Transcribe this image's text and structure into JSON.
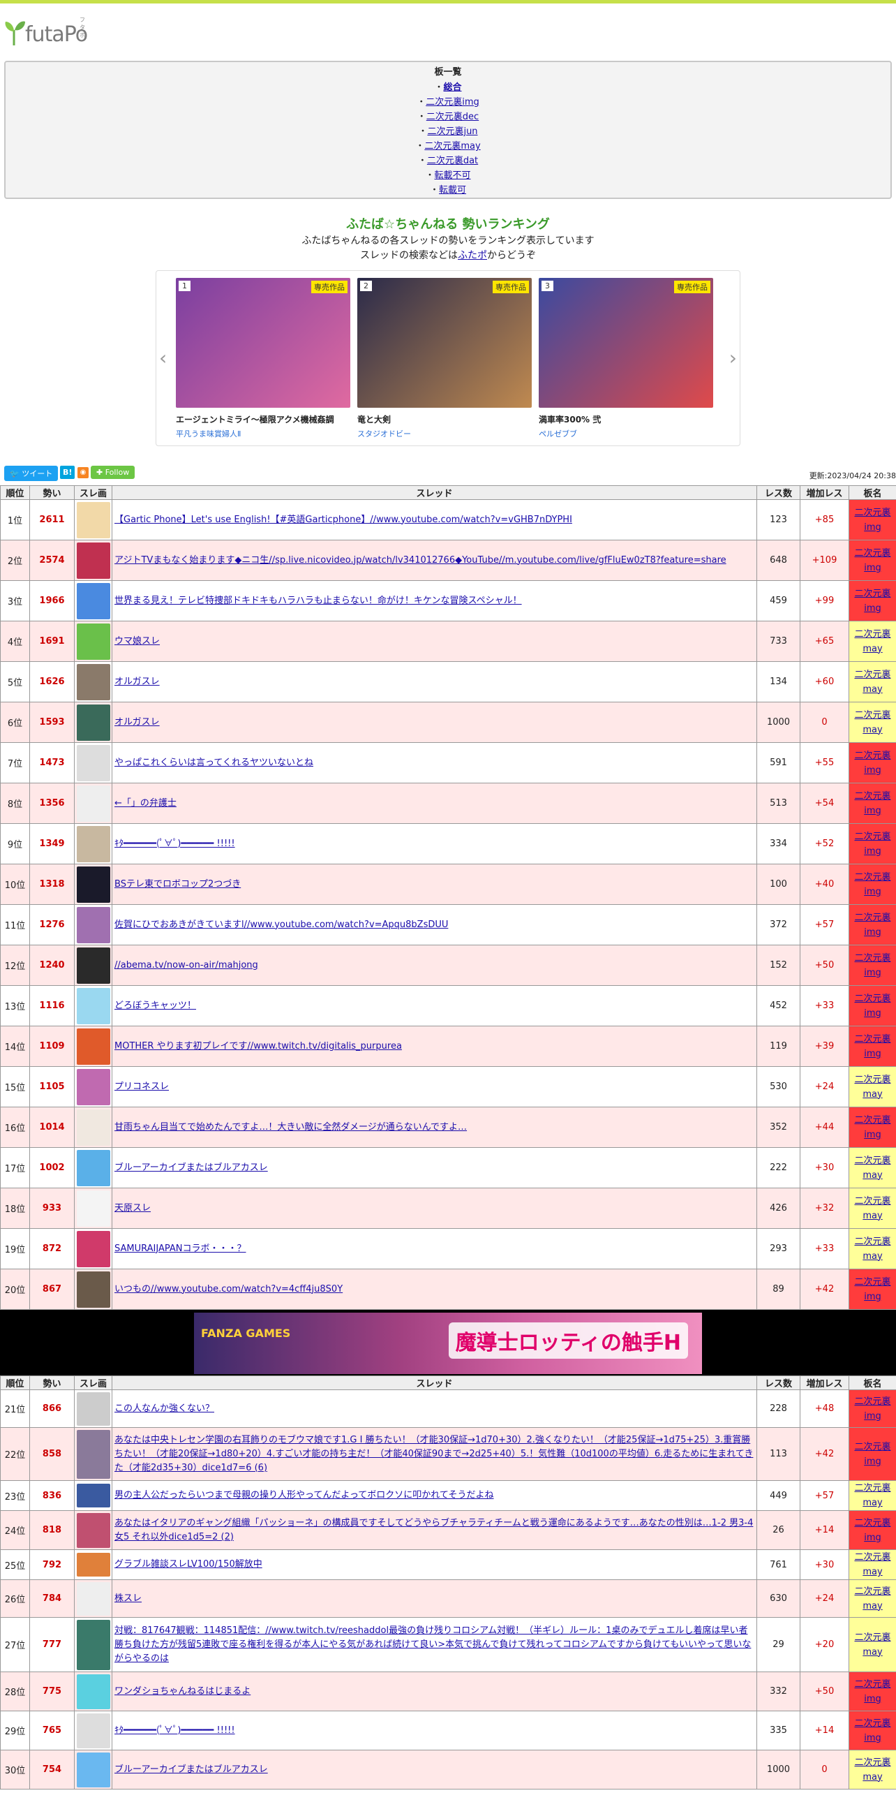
{
  "logo": {
    "text": "futaPo",
    "ruby": "フタポ"
  },
  "boards": {
    "title": "板一覧",
    "items": [
      {
        "label": "総合",
        "bold": true
      },
      {
        "label": "二次元裏img"
      },
      {
        "label": "二次元裏dec"
      },
      {
        "label": "二次元裏jun"
      },
      {
        "label": "二次元裏may"
      },
      {
        "label": "二次元裏dat"
      },
      {
        "label": "転載不可"
      },
      {
        "label": "転載可"
      }
    ]
  },
  "ranking": {
    "title": "ふたば☆ちゃんねる 勢いランキング",
    "desc1": "ふたばちゃんねるの各スレッドの勢いをランキング表示しています",
    "desc2_pre": "スレッドの検索などは",
    "desc2_link": "ふたポ",
    "desc2_post": "からどうぞ"
  },
  "carousel": [
    {
      "rank": "1",
      "badge": "専売作品",
      "title": "エージェントミライ～極限アクメ機械姦調",
      "maker": "平凡うま味賞婦人Ⅱ",
      "color1": "#7a3fa0",
      "color2": "#e06aa0"
    },
    {
      "rank": "2",
      "badge": "専売作品",
      "title": "竜と大剣",
      "maker": "スタジオドビー",
      "color1": "#2a2a4a",
      "color2": "#c08a50"
    },
    {
      "rank": "3",
      "badge": "専売作品",
      "title": "満車率300% 弐",
      "maker": "ペルゼブブ",
      "color1": "#3a4aa0",
      "color2": "#e04a4a"
    }
  ],
  "social": {
    "tweet": "ツイート",
    "hatena": "B!",
    "follow": "Follow",
    "updated": "更新:2023/04/24 20:38"
  },
  "table": {
    "headers": [
      "順位",
      "勢い",
      "スレ画",
      "スレッド",
      "レス数",
      "増加レス",
      "板名"
    ]
  },
  "rows_a": [
    {
      "pos": "1位",
      "mom": "2611",
      "title": "【Gartic Phone】Let's use English!【#英語Garticphone】//www.youtube.com/watch?v=vGHB7nDYPHI",
      "res": "123",
      "inc": "+85",
      "board1": "二次元裏",
      "board2": "img",
      "bt": "img",
      "tc": "#f2d9a8"
    },
    {
      "pos": "2位",
      "mom": "2574",
      "title": "アジトTVまもなく始まります◆ニコ生//sp.live.nicovideo.jp/watch/lv341012766◆YouTube//m.youtube.com/live/gfFluEw0zT8?feature=share",
      "res": "648",
      "inc": "+109",
      "board1": "二次元裏",
      "board2": "img",
      "bt": "img",
      "tc": "#c03050"
    },
    {
      "pos": "3位",
      "mom": "1966",
      "title": "世界まる見え！テレビ特捜部ドキドキもハラハラも止まらない！命がけ！キケンな冒険スペシャル！",
      "res": "459",
      "inc": "+99",
      "board1": "二次元裏",
      "board2": "img",
      "bt": "img",
      "tc": "#4a8ae0"
    },
    {
      "pos": "4位",
      "mom": "1691",
      "title": "ウマ娘スレ",
      "res": "733",
      "inc": "+65",
      "board1": "二次元裏",
      "board2": "may",
      "bt": "may",
      "tc": "#6ac04a"
    },
    {
      "pos": "5位",
      "mom": "1626",
      "title": "オルガスレ",
      "res": "134",
      "inc": "+60",
      "board1": "二次元裏",
      "board2": "may",
      "bt": "may",
      "tc": "#8a7a6a"
    },
    {
      "pos": "6位",
      "mom": "1593",
      "title": "オルガスレ",
      "res": "1000",
      "inc": "0",
      "board1": "二次元裏",
      "board2": "may",
      "bt": "may",
      "tc": "#3a6a5a"
    },
    {
      "pos": "7位",
      "mom": "1473",
      "title": "やっぱこれくらいは言ってくれるヤツいないとね",
      "res": "591",
      "inc": "+55",
      "board1": "二次元裏",
      "board2": "img",
      "bt": "img",
      "tc": "#dddddd"
    },
    {
      "pos": "8位",
      "mom": "1356",
      "title": "←「」の弁護士",
      "res": "513",
      "inc": "+54",
      "board1": "二次元裏",
      "board2": "img",
      "bt": "img",
      "tc": "#eeeeee"
    },
    {
      "pos": "9位",
      "mom": "1349",
      "title": "ｷﾀ━━━━━━(ﾟ∀ﾟ)━━━━━━ !!!!!",
      "res": "334",
      "inc": "+52",
      "board1": "二次元裏",
      "board2": "img",
      "bt": "img",
      "tc": "#c8b8a0"
    },
    {
      "pos": "10位",
      "mom": "1318",
      "title": "BSテレ東でロボコップ2つづき",
      "res": "100",
      "inc": "+40",
      "board1": "二次元裏",
      "board2": "img",
      "bt": "img",
      "tc": "#1a1a2a"
    },
    {
      "pos": "11位",
      "mom": "1276",
      "title": "佐賀にひでおあきがきていますl//www.youtube.com/watch?v=Apqu8bZsDUU",
      "res": "372",
      "inc": "+57",
      "board1": "二次元裏",
      "board2": "img",
      "bt": "img",
      "tc": "#a070b0"
    },
    {
      "pos": "12位",
      "mom": "1240",
      "title": "//abema.tv/now-on-air/mahjong",
      "res": "152",
      "inc": "+50",
      "board1": "二次元裏",
      "board2": "img",
      "bt": "img",
      "tc": "#2a2a2a"
    },
    {
      "pos": "13位",
      "mom": "1116",
      "title": "どろぼうキャッツ！",
      "res": "452",
      "inc": "+33",
      "board1": "二次元裏",
      "board2": "img",
      "bt": "img",
      "tc": "#9ad8f0"
    },
    {
      "pos": "14位",
      "mom": "1109",
      "title": "MOTHER やります初プレイです//www.twitch.tv/digitalis_purpurea",
      "res": "119",
      "inc": "+39",
      "board1": "二次元裏",
      "board2": "img",
      "bt": "img",
      "tc": "#e05a2a"
    },
    {
      "pos": "15位",
      "mom": "1105",
      "title": "プリコネスレ",
      "res": "530",
      "inc": "+24",
      "board1": "二次元裏",
      "board2": "may",
      "bt": "may",
      "tc": "#c06ab0"
    },
    {
      "pos": "16位",
      "mom": "1014",
      "title": "甘雨ちゃん目当てで始めたんですよ…！大きい敵に全然ダメージが通らないんですよ…",
      "res": "352",
      "inc": "+44",
      "board1": "二次元裏",
      "board2": "img",
      "bt": "img",
      "tc": "#f0e8e0"
    },
    {
      "pos": "17位",
      "mom": "1002",
      "title": "ブルーアーカイブまたはブルアカスレ",
      "res": "222",
      "inc": "+30",
      "board1": "二次元裏",
      "board2": "may",
      "bt": "may",
      "tc": "#5ab0e8"
    },
    {
      "pos": "18位",
      "mom": "933",
      "title": "天原スレ",
      "res": "426",
      "inc": "+32",
      "board1": "二次元裏",
      "board2": "may",
      "bt": "may",
      "tc": "#f4f4f4"
    },
    {
      "pos": "19位",
      "mom": "872",
      "title": "SAMURAIJAPANコラボ・・・？",
      "res": "293",
      "inc": "+33",
      "board1": "二次元裏",
      "board2": "may",
      "bt": "may",
      "tc": "#d03a6a"
    },
    {
      "pos": "20位",
      "mom": "867",
      "title": "いつもの//www.youtube.com/watch?v=4cff4ju8S0Y",
      "res": "89",
      "inc": "+42",
      "board1": "二次元裏",
      "board2": "img",
      "bt": "img",
      "tc": "#6a5a4a"
    }
  ],
  "banner": {
    "left": "FANZA GAMES",
    "right": "魔導士ロッティの触手H"
  },
  "rows_b": [
    {
      "pos": "21位",
      "mom": "866",
      "title": "この人なんか強くない？",
      "res": "228",
      "inc": "+48",
      "board1": "二次元裏",
      "board2": "img",
      "bt": "img",
      "tc": "#cccccc",
      "h": 54
    },
    {
      "pos": "22位",
      "mom": "858",
      "title": "あなたは中央トレセン学園の右耳飾りのモブウマ娘です1.G I 勝ちたい！（才能30保証→1d70+30）2.強くなりたい！（才能25保証→1d75+25）3.重賞勝ちたい！（才能20保証→1d80+20）4.すごい才能の持ち主だ！（才能40保証90まで→2d25+40）5.！気性難（10d100の平均値）6.走るために生まれてきた（才能2d35+30）dice1d7=6 (6)",
      "res": "113",
      "inc": "+42",
      "board1": "二次元裏",
      "board2": "img",
      "bt": "img",
      "tc": "#8a7a9a",
      "h": 76
    },
    {
      "pos": "23位",
      "mom": "836",
      "title": "男の主人公だったらいつまで母親の操り人形やってんだよってボロクソに叩かれてそうだよね",
      "res": "449",
      "inc": "+57",
      "board1": "二次元裏",
      "board2": "may",
      "bt": "may",
      "tc": "#3a5aa0",
      "h": 40
    },
    {
      "pos": "24位",
      "mom": "818",
      "title": "あなたはイタリアのギャング組織「パッショーネ」の構成員ですそしてどうやらブチャラティチームと戦う運命にあるようです…あなたの性別は…1-2 男3-4 女5 それ以外dice1d5=2 (2)",
      "res": "26",
      "inc": "+14",
      "board1": "二次元裏",
      "board2": "img",
      "bt": "img",
      "tc": "#c05070",
      "h": 56
    },
    {
      "pos": "25位",
      "mom": "792",
      "title": "グラブル雑談スレLV100/150解放中",
      "res": "761",
      "inc": "+30",
      "board1": "二次元裏",
      "board2": "may",
      "bt": "may",
      "tc": "#e0803a",
      "h": 40
    },
    {
      "pos": "26位",
      "mom": "784",
      "title": "株スレ",
      "res": "630",
      "inc": "+24",
      "board1": "二次元裏",
      "board2": "may",
      "bt": "may",
      "tc": "#eeeeee",
      "h": 54
    },
    {
      "pos": "27位",
      "mom": "777",
      "title": "対戦：817647観戦：114851配信：//www.twitch.tv/reeshaddol最強の負け残りコロシアム対戦！（半ギレ）ルール：1桌のみでデュエルし着席は早い者勝ち負けた方が残留5連敗で座る権利を得るが本人にやる気があれば続けて良い>本気で挑んで負けて残れってコロシアムですから負けてもいいやって思いながらやるのは",
      "res": "29",
      "inc": "+20",
      "board1": "二次元裏",
      "board2": "may",
      "bt": "may",
      "tc": "#3a7a6a",
      "h": 78
    },
    {
      "pos": "28位",
      "mom": "775",
      "title": "ワンダショちゃんねるはじまるよ",
      "res": "332",
      "inc": "+50",
      "board1": "二次元裏",
      "board2": "img",
      "bt": "img",
      "tc": "#5ad0e0",
      "h": 56
    },
    {
      "pos": "29位",
      "mom": "765",
      "title": "ｷﾀ━━━━━━(ﾟ∀ﾟ)━━━━━━ !!!!!",
      "res": "335",
      "inc": "+14",
      "board1": "二次元裏",
      "board2": "img",
      "bt": "img",
      "tc": "#dddddd",
      "h": 56
    },
    {
      "pos": "30位",
      "mom": "754",
      "title": "ブルーアーカイブまたはブルアカスレ",
      "res": "1000",
      "inc": "0",
      "board1": "二次元裏",
      "board2": "may",
      "bt": "may",
      "tc": "#6ab8f0",
      "h": 56
    }
  ]
}
